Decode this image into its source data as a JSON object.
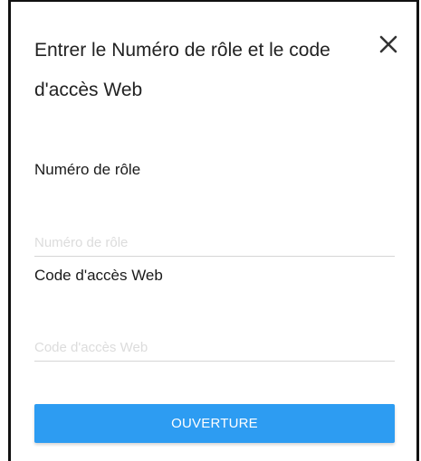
{
  "dialog": {
    "title": "Entrer le Numéro de rôle et le code d'accès Web",
    "close_icon": "close-icon"
  },
  "form": {
    "role_number": {
      "label": "Numéro de rôle",
      "placeholder": "Numéro de rôle",
      "value": ""
    },
    "web_access_code": {
      "label": "Code d'accès Web",
      "placeholder": "Code d'accès Web",
      "value": ""
    },
    "submit_label": "OUVERTURE"
  },
  "colors": {
    "accent": "#2d9cf2",
    "button_text": "#ffffff",
    "placeholder": "#dcdcdc",
    "underline": "#d6d6d6"
  }
}
